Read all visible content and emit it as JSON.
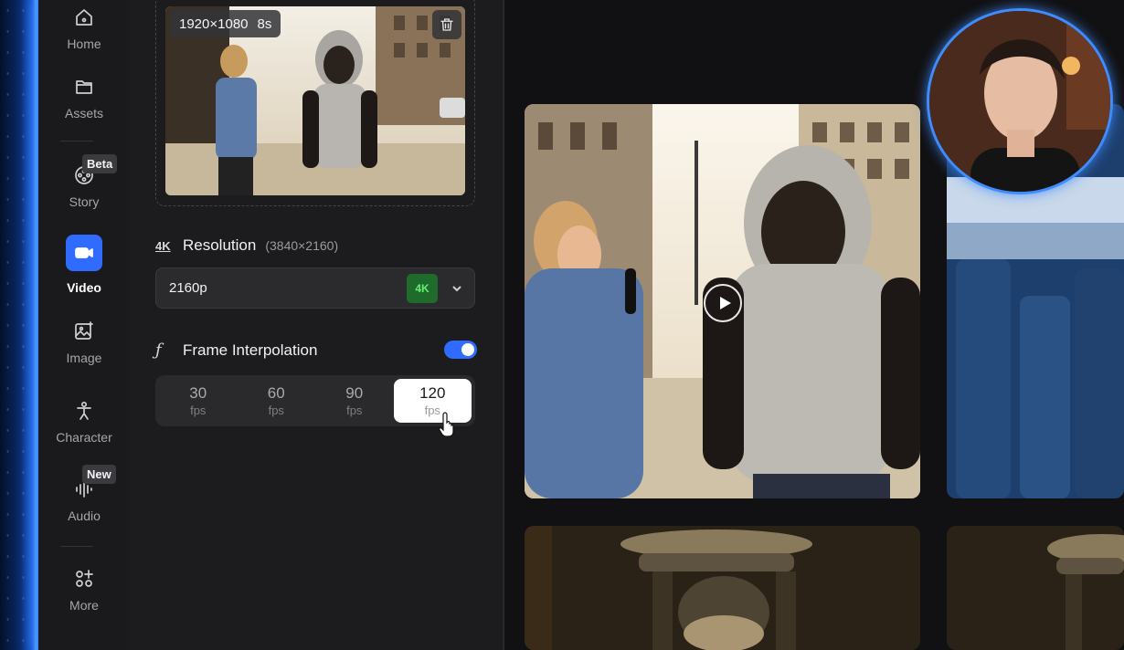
{
  "sidebar": {
    "items": [
      {
        "label": "Home",
        "icon": "home-icon"
      },
      {
        "label": "Assets",
        "icon": "folder-icon"
      },
      {
        "label": "Story",
        "icon": "film-reel-icon",
        "badge": "Beta"
      },
      {
        "label": "Video",
        "icon": "video-camera-icon",
        "active": true
      },
      {
        "label": "Image",
        "icon": "image-icon"
      },
      {
        "label": "Character",
        "icon": "character-icon"
      },
      {
        "label": "Audio",
        "icon": "audio-wave-icon",
        "badge": "New"
      },
      {
        "label": "More",
        "icon": "grid-plus-icon"
      }
    ]
  },
  "reference": {
    "dimensions": "1920×1080",
    "duration": "8s"
  },
  "resolution": {
    "badge_icon": "4K",
    "title": "Resolution",
    "subtitle": "(3840×2160)",
    "selected": "2160p",
    "quality_badge": "4K"
  },
  "interpolation": {
    "icon": "ƒ",
    "title": "Frame Interpolation",
    "enabled": true,
    "unit": "fps",
    "options": [
      "30",
      "60",
      "90",
      "120"
    ],
    "selected": "120"
  },
  "colors": {
    "accent": "#2f6bff",
    "panel": "#1c1c1e",
    "badge_green": "#63ef72"
  }
}
